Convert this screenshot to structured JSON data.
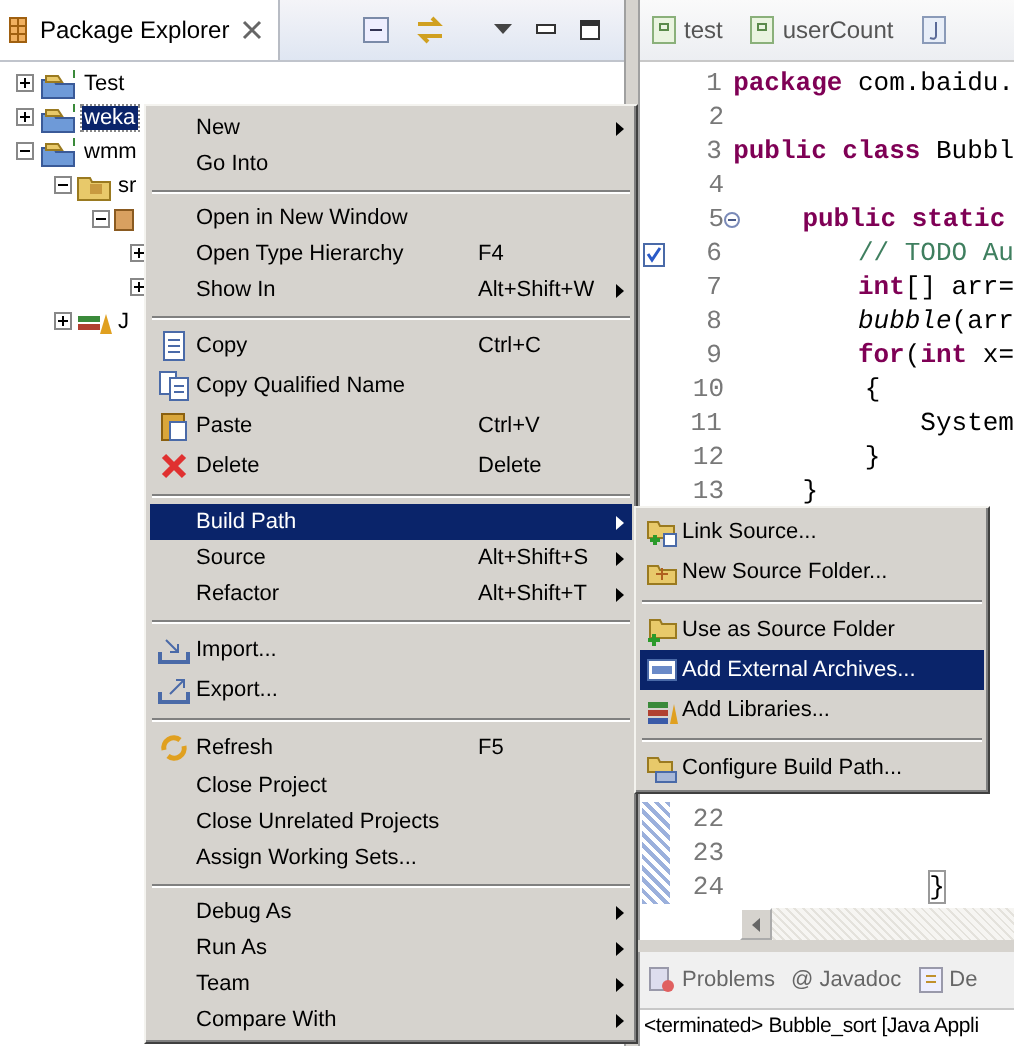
{
  "explorer": {
    "title": "Package Explorer",
    "tree": [
      {
        "label": "Test",
        "expanded": false,
        "selected": false,
        "kind": "project"
      },
      {
        "label": "weka",
        "expanded": false,
        "selected": true,
        "kind": "project"
      },
      {
        "label": "wmm",
        "expanded": true,
        "selected": false,
        "kind": "project",
        "children": [
          {
            "label": "sr",
            "expanded": true,
            "selected": false,
            "kind": "folder",
            "children": [
              {
                "expanded": true,
                "kind": "package",
                "children": [
                  {
                    "expanded": false
                  },
                  {
                    "expanded": false
                  }
                ]
              }
            ]
          },
          {
            "label": "J",
            "expanded": false,
            "selected": false,
            "kind": "library"
          }
        ]
      }
    ]
  },
  "editor": {
    "tabs": [
      {
        "label": "test",
        "kind": "class"
      },
      {
        "label": "userCount",
        "kind": "class"
      },
      {
        "kind": "java"
      }
    ],
    "lines": [
      {
        "number": "1",
        "code": [
          {
            "text": "package",
            "kind": "keyword"
          },
          {
            "text": " com.baidu.",
            "kind": "plain"
          }
        ]
      },
      {
        "number": "2"
      },
      {
        "number": "3",
        "code": [
          {
            "text": "public class",
            "kind": "keyword"
          },
          {
            "text": " Bubbl",
            "kind": "plain"
          }
        ]
      },
      {
        "number": "4"
      },
      {
        "number": "5",
        "fold": true,
        "code": [
          {
            "text": "    public static",
            "kind": "keyword"
          }
        ]
      },
      {
        "number": "6",
        "task": true,
        "code": [
          {
            "text": "        // TODO Au",
            "kind": "comment"
          }
        ]
      },
      {
        "number": "7",
        "code": [
          {
            "text": "        int",
            "kind": "keyword"
          },
          {
            "text": "[] arr=",
            "kind": "plain"
          }
        ]
      },
      {
        "number": "8",
        "code": [
          {
            "text": "        bubble",
            "kind": "italic"
          },
          {
            "text": "(arr",
            "kind": "plain"
          }
        ]
      },
      {
        "number": "9",
        "code": [
          {
            "text": "        for",
            "kind": "keyword"
          },
          {
            "text": "(",
            "kind": "plain"
          },
          {
            "text": "int",
            "kind": "keyword"
          },
          {
            "text": " x=",
            "kind": "plain"
          }
        ]
      },
      {
        "number": "10",
        "code": [
          {
            "text": "        {",
            "kind": "plain"
          }
        ]
      },
      {
        "number": "11",
        "code": [
          {
            "text": "            System",
            "kind": "plain"
          }
        ]
      },
      {
        "number": "12",
        "code": [
          {
            "text": "        }",
            "kind": "plain"
          }
        ]
      },
      {
        "number": "13",
        "code": [
          {
            "text": "    }",
            "kind": "plain"
          }
        ]
      }
    ],
    "lower_lines": [
      {
        "number": "22"
      },
      {
        "number": "23"
      },
      {
        "number": "24",
        "code": [
          {
            "text": "}",
            "kind": "bracket"
          }
        ]
      }
    ]
  },
  "bottom_panel": {
    "tabs": [
      {
        "label": "Problems"
      },
      {
        "label": "@ Javadoc"
      },
      {
        "label": "De"
      }
    ],
    "console": "<terminated> Bubble_sort [Java Appli"
  },
  "context_menu": {
    "items": [
      {
        "kind": "item",
        "label": "New",
        "submenu": true,
        "selected": false
      },
      {
        "kind": "item",
        "label": "Go Into",
        "selected": false
      },
      {
        "kind": "separator"
      },
      {
        "kind": "item",
        "label": "Open in New Window",
        "selected": false
      },
      {
        "kind": "item",
        "label": "Open Type Hierarchy",
        "shortcut": "F4",
        "selected": false
      },
      {
        "kind": "item",
        "label": "Show In",
        "shortcut": "Alt+Shift+W",
        "submenu": true,
        "selected": false
      },
      {
        "kind": "separator"
      },
      {
        "kind": "item",
        "label": "Copy",
        "shortcut": "Ctrl+C",
        "selected": false
      },
      {
        "kind": "item",
        "label": "Copy Qualified Name",
        "selected": false
      },
      {
        "kind": "item",
        "label": "Paste",
        "shortcut": "Ctrl+V",
        "selected": false
      },
      {
        "kind": "item",
        "label": "Delete",
        "shortcut": "Delete",
        "selected": false
      },
      {
        "kind": "separator"
      },
      {
        "kind": "item",
        "label": "Build Path",
        "submenu": true,
        "selected": true
      },
      {
        "kind": "item",
        "label": "Source",
        "shortcut": "Alt+Shift+S",
        "submenu": true,
        "selected": false
      },
      {
        "kind": "item",
        "label": "Refactor",
        "shortcut": "Alt+Shift+T",
        "submenu": true,
        "selected": false
      },
      {
        "kind": "separator"
      },
      {
        "kind": "item",
        "label": "Import...",
        "selected": false
      },
      {
        "kind": "item",
        "label": "Export...",
        "selected": false
      },
      {
        "kind": "separator"
      },
      {
        "kind": "item",
        "label": "Refresh",
        "shortcut": "F5",
        "selected": false
      },
      {
        "kind": "item",
        "label": "Close Project",
        "selected": false
      },
      {
        "kind": "item",
        "label": "Close Unrelated Projects",
        "selected": false
      },
      {
        "kind": "item",
        "label": "Assign Working Sets...",
        "selected": false
      },
      {
        "kind": "separator"
      },
      {
        "kind": "item",
        "label": "Debug As",
        "submenu": true,
        "selected": false
      },
      {
        "kind": "item",
        "label": "Run As",
        "submenu": true,
        "selected": false
      },
      {
        "kind": "item",
        "label": "Team",
        "submenu": true,
        "selected": false
      },
      {
        "kind": "item",
        "label": "Compare With",
        "submenu": true,
        "selected": false
      }
    ]
  },
  "build_path_menu": {
    "items": [
      {
        "kind": "item",
        "label": "Link Source...",
        "selected": false
      },
      {
        "kind": "item",
        "label": "New Source Folder...",
        "selected": false
      },
      {
        "kind": "separator"
      },
      {
        "kind": "item",
        "label": "Use as Source Folder",
        "selected": false
      },
      {
        "kind": "item",
        "label": "Add External Archives...",
        "selected": true
      },
      {
        "kind": "item",
        "label": "Add Libraries...",
        "selected": false
      },
      {
        "kind": "separator"
      },
      {
        "kind": "item",
        "label": "Configure Build Path...",
        "selected": false
      }
    ]
  }
}
